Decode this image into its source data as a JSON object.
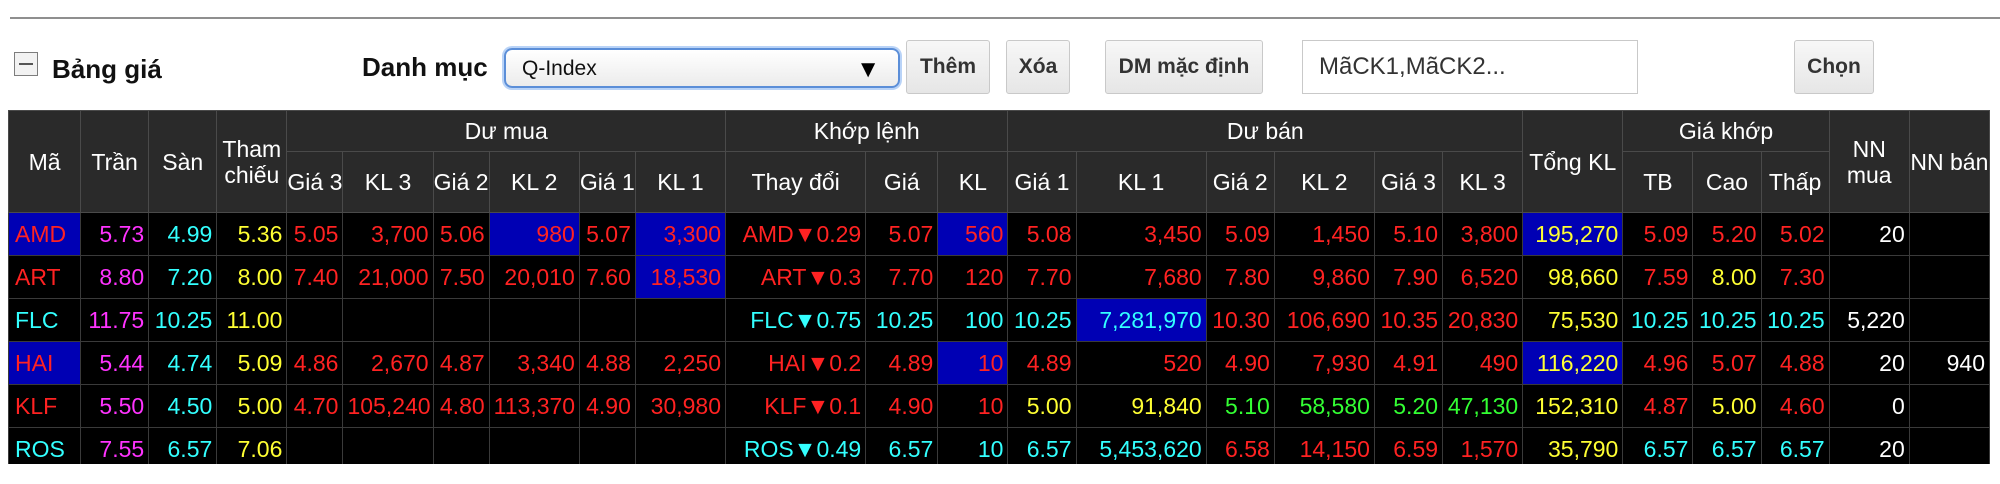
{
  "section": {
    "title": "Bảng giá",
    "category_label": "Danh mục",
    "category_value": "Q-Index"
  },
  "toolbar": {
    "add_label": "Thêm",
    "delete_label": "Xóa",
    "default_label": "DM mặc định",
    "choose_label": "Chọn",
    "symbols_placeholder": "MãCK1,MãCK2..."
  },
  "headers": {
    "ma": "Mã",
    "tran": "Trần",
    "san": "Sàn",
    "tham_chieu": "Tham chiếu",
    "du_mua": "Dư mua",
    "khop_lenh": "Khớp lệnh",
    "du_ban": "Dư bán",
    "tong_kl": "Tổng KL",
    "gia_khop": "Giá khớp",
    "nn_mua": "NN mua",
    "nn_ban": "NN bán",
    "sub": {
      "gia3": "Giá 3",
      "kl3": "KL 3",
      "gia2": "Giá 2",
      "kl2": "KL 2",
      "gia1": "Giá 1",
      "kl1": "KL 1",
      "thay_doi": "Thay đổi",
      "gia": "Giá",
      "kl": "KL",
      "ban_gia1": "Giá 1",
      "ban_kl1": "KL 1",
      "ban_gia2": "Giá 2",
      "ban_kl2": "KL 2",
      "ban_gia3": "Giá 3",
      "ban_kl3": "KL 3",
      "tb": "TB",
      "cao": "Cao",
      "thap": "Thấp"
    }
  },
  "colors": {
    "red": "#ff2222",
    "pink": "#ff33ff",
    "cyan": "#33ffff",
    "yellow": "#ffff33",
    "green": "#33ff33",
    "white": "#ffffff",
    "highlight": "#0000b4"
  },
  "rows": [
    {
      "sym": {
        "v": "AMD",
        "c": "red",
        "h": true
      },
      "tran": {
        "v": "5.73",
        "c": "pink"
      },
      "san": {
        "v": "4.99",
        "c": "cyan"
      },
      "ref": {
        "v": "5.36",
        "c": "yellow"
      },
      "b_g3": {
        "v": "5.05",
        "c": "red"
      },
      "b_k3": {
        "v": "3,700",
        "c": "red"
      },
      "b_g2": {
        "v": "5.06",
        "c": "red"
      },
      "b_k2": {
        "v": "980",
        "c": "red",
        "h": true
      },
      "b_g1": {
        "v": "5.07",
        "c": "red"
      },
      "b_k1": {
        "v": "3,300",
        "c": "red",
        "h": true
      },
      "chg": {
        "v": "AMD▼0.29",
        "c": "red"
      },
      "m_gia": {
        "v": "5.07",
        "c": "red"
      },
      "m_kl": {
        "v": "560",
        "c": "red",
        "h": true
      },
      "s_g1": {
        "v": "5.08",
        "c": "red"
      },
      "s_k1": {
        "v": "3,450",
        "c": "red"
      },
      "s_g2": {
        "v": "5.09",
        "c": "red"
      },
      "s_k2": {
        "v": "1,450",
        "c": "red"
      },
      "s_g3": {
        "v": "5.10",
        "c": "red"
      },
      "s_k3": {
        "v": "3,800",
        "c": "red"
      },
      "tong": {
        "v": "195,270",
        "c": "yellow",
        "h": true
      },
      "tb": {
        "v": "5.09",
        "c": "red"
      },
      "cao": {
        "v": "5.20",
        "c": "red"
      },
      "thap": {
        "v": "5.02",
        "c": "red"
      },
      "nn_mua": {
        "v": "20",
        "c": "white"
      },
      "nn_ban": {
        "v": "",
        "c": "white"
      }
    },
    {
      "sym": {
        "v": "ART",
        "c": "red"
      },
      "tran": {
        "v": "8.80",
        "c": "pink"
      },
      "san": {
        "v": "7.20",
        "c": "cyan"
      },
      "ref": {
        "v": "8.00",
        "c": "yellow"
      },
      "b_g3": {
        "v": "7.40",
        "c": "red"
      },
      "b_k3": {
        "v": "21,000",
        "c": "red"
      },
      "b_g2": {
        "v": "7.50",
        "c": "red"
      },
      "b_k2": {
        "v": "20,010",
        "c": "red"
      },
      "b_g1": {
        "v": "7.60",
        "c": "red"
      },
      "b_k1": {
        "v": "18,530",
        "c": "red",
        "h": true
      },
      "chg": {
        "v": "ART▼0.3",
        "c": "red"
      },
      "m_gia": {
        "v": "7.70",
        "c": "red"
      },
      "m_kl": {
        "v": "120",
        "c": "red"
      },
      "s_g1": {
        "v": "7.70",
        "c": "red"
      },
      "s_k1": {
        "v": "7,680",
        "c": "red"
      },
      "s_g2": {
        "v": "7.80",
        "c": "red"
      },
      "s_k2": {
        "v": "9,860",
        "c": "red"
      },
      "s_g3": {
        "v": "7.90",
        "c": "red"
      },
      "s_k3": {
        "v": "6,520",
        "c": "red"
      },
      "tong": {
        "v": "98,660",
        "c": "yellow"
      },
      "tb": {
        "v": "7.59",
        "c": "red"
      },
      "cao": {
        "v": "8.00",
        "c": "yellow"
      },
      "thap": {
        "v": "7.30",
        "c": "red"
      },
      "nn_mua": {
        "v": "",
        "c": "white"
      },
      "nn_ban": {
        "v": "",
        "c": "white"
      }
    },
    {
      "sym": {
        "v": "FLC",
        "c": "cyan"
      },
      "tran": {
        "v": "11.75",
        "c": "pink"
      },
      "san": {
        "v": "10.25",
        "c": "cyan"
      },
      "ref": {
        "v": "11.00",
        "c": "yellow"
      },
      "b_g3": {
        "v": "",
        "c": "white"
      },
      "b_k3": {
        "v": "",
        "c": "white"
      },
      "b_g2": {
        "v": "",
        "c": "white"
      },
      "b_k2": {
        "v": "",
        "c": "white"
      },
      "b_g1": {
        "v": "",
        "c": "white"
      },
      "b_k1": {
        "v": "",
        "c": "white"
      },
      "chg": {
        "v": "FLC▼0.75",
        "c": "cyan"
      },
      "m_gia": {
        "v": "10.25",
        "c": "cyan"
      },
      "m_kl": {
        "v": "100",
        "c": "cyan"
      },
      "s_g1": {
        "v": "10.25",
        "c": "cyan"
      },
      "s_k1": {
        "v": "7,281,970",
        "c": "cyan",
        "h": true
      },
      "s_g2": {
        "v": "10.30",
        "c": "red"
      },
      "s_k2": {
        "v": "106,690",
        "c": "red"
      },
      "s_g3": {
        "v": "10.35",
        "c": "red"
      },
      "s_k3": {
        "v": "20,830",
        "c": "red"
      },
      "tong": {
        "v": "75,530",
        "c": "yellow"
      },
      "tb": {
        "v": "10.25",
        "c": "cyan"
      },
      "cao": {
        "v": "10.25",
        "c": "cyan"
      },
      "thap": {
        "v": "10.25",
        "c": "cyan"
      },
      "nn_mua": {
        "v": "5,220",
        "c": "white"
      },
      "nn_ban": {
        "v": "",
        "c": "white"
      }
    },
    {
      "sym": {
        "v": "HAI",
        "c": "red",
        "h": true
      },
      "tran": {
        "v": "5.44",
        "c": "pink"
      },
      "san": {
        "v": "4.74",
        "c": "cyan"
      },
      "ref": {
        "v": "5.09",
        "c": "yellow"
      },
      "b_g3": {
        "v": "4.86",
        "c": "red"
      },
      "b_k3": {
        "v": "2,670",
        "c": "red"
      },
      "b_g2": {
        "v": "4.87",
        "c": "red"
      },
      "b_k2": {
        "v": "3,340",
        "c": "red"
      },
      "b_g1": {
        "v": "4.88",
        "c": "red"
      },
      "b_k1": {
        "v": "2,250",
        "c": "red"
      },
      "chg": {
        "v": "HAI▼0.2",
        "c": "red"
      },
      "m_gia": {
        "v": "4.89",
        "c": "red"
      },
      "m_kl": {
        "v": "10",
        "c": "red",
        "h": true
      },
      "s_g1": {
        "v": "4.89",
        "c": "red"
      },
      "s_k1": {
        "v": "520",
        "c": "red"
      },
      "s_g2": {
        "v": "4.90",
        "c": "red"
      },
      "s_k2": {
        "v": "7,930",
        "c": "red"
      },
      "s_g3": {
        "v": "4.91",
        "c": "red"
      },
      "s_k3": {
        "v": "490",
        "c": "red"
      },
      "tong": {
        "v": "116,220",
        "c": "yellow",
        "h": true
      },
      "tb": {
        "v": "4.96",
        "c": "red"
      },
      "cao": {
        "v": "5.07",
        "c": "red"
      },
      "thap": {
        "v": "4.88",
        "c": "red"
      },
      "nn_mua": {
        "v": "20",
        "c": "white"
      },
      "nn_ban": {
        "v": "940",
        "c": "white"
      }
    },
    {
      "sym": {
        "v": "KLF",
        "c": "red"
      },
      "tran": {
        "v": "5.50",
        "c": "pink"
      },
      "san": {
        "v": "4.50",
        "c": "cyan"
      },
      "ref": {
        "v": "5.00",
        "c": "yellow"
      },
      "b_g3": {
        "v": "4.70",
        "c": "red"
      },
      "b_k3": {
        "v": "105,240",
        "c": "red"
      },
      "b_g2": {
        "v": "4.80",
        "c": "red"
      },
      "b_k2": {
        "v": "113,370",
        "c": "red"
      },
      "b_g1": {
        "v": "4.90",
        "c": "red"
      },
      "b_k1": {
        "v": "30,980",
        "c": "red"
      },
      "chg": {
        "v": "KLF▼0.1",
        "c": "red"
      },
      "m_gia": {
        "v": "4.90",
        "c": "red"
      },
      "m_kl": {
        "v": "10",
        "c": "red"
      },
      "s_g1": {
        "v": "5.00",
        "c": "yellow"
      },
      "s_k1": {
        "v": "91,840",
        "c": "yellow"
      },
      "s_g2": {
        "v": "5.10",
        "c": "green"
      },
      "s_k2": {
        "v": "58,580",
        "c": "green"
      },
      "s_g3": {
        "v": "5.20",
        "c": "green"
      },
      "s_k3": {
        "v": "47,130",
        "c": "green"
      },
      "tong": {
        "v": "152,310",
        "c": "yellow"
      },
      "tb": {
        "v": "4.87",
        "c": "red"
      },
      "cao": {
        "v": "5.00",
        "c": "yellow"
      },
      "thap": {
        "v": "4.60",
        "c": "red"
      },
      "nn_mua": {
        "v": "0",
        "c": "white"
      },
      "nn_ban": {
        "v": "",
        "c": "white"
      }
    },
    {
      "sym": {
        "v": "ROS",
        "c": "cyan"
      },
      "tran": {
        "v": "7.55",
        "c": "pink"
      },
      "san": {
        "v": "6.57",
        "c": "cyan"
      },
      "ref": {
        "v": "7.06",
        "c": "yellow"
      },
      "b_g3": {
        "v": "",
        "c": "white"
      },
      "b_k3": {
        "v": "",
        "c": "white"
      },
      "b_g2": {
        "v": "",
        "c": "white"
      },
      "b_k2": {
        "v": "",
        "c": "white"
      },
      "b_g1": {
        "v": "",
        "c": "white"
      },
      "b_k1": {
        "v": "",
        "c": "white"
      },
      "chg": {
        "v": "ROS▼0.49",
        "c": "cyan"
      },
      "m_gia": {
        "v": "6.57",
        "c": "cyan"
      },
      "m_kl": {
        "v": "10",
        "c": "cyan"
      },
      "s_g1": {
        "v": "6.57",
        "c": "cyan"
      },
      "s_k1": {
        "v": "5,453,620",
        "c": "cyan"
      },
      "s_g2": {
        "v": "6.58",
        "c": "red"
      },
      "s_k2": {
        "v": "14,150",
        "c": "red"
      },
      "s_g3": {
        "v": "6.59",
        "c": "red"
      },
      "s_k3": {
        "v": "1,570",
        "c": "red"
      },
      "tong": {
        "v": "35,790",
        "c": "yellow"
      },
      "tb": {
        "v": "6.57",
        "c": "cyan"
      },
      "cao": {
        "v": "6.57",
        "c": "cyan"
      },
      "thap": {
        "v": "6.57",
        "c": "cyan"
      },
      "nn_mua": {
        "v": "20",
        "c": "white"
      },
      "nn_ban": {
        "v": "",
        "c": "white"
      }
    }
  ]
}
